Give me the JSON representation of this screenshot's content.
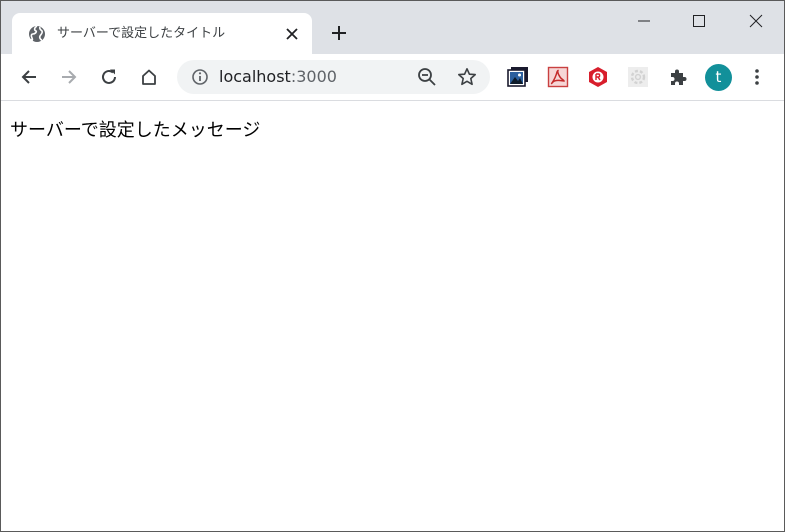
{
  "tab": {
    "title": "サーバーで設定したタイトル",
    "favicon": "globe-icon"
  },
  "toolbar": {
    "url_host": "localhost",
    "url_port": ":3000"
  },
  "profile": {
    "initial": "t",
    "color": "#12909a"
  },
  "page": {
    "message": "サーバーで設定したメッセージ"
  }
}
